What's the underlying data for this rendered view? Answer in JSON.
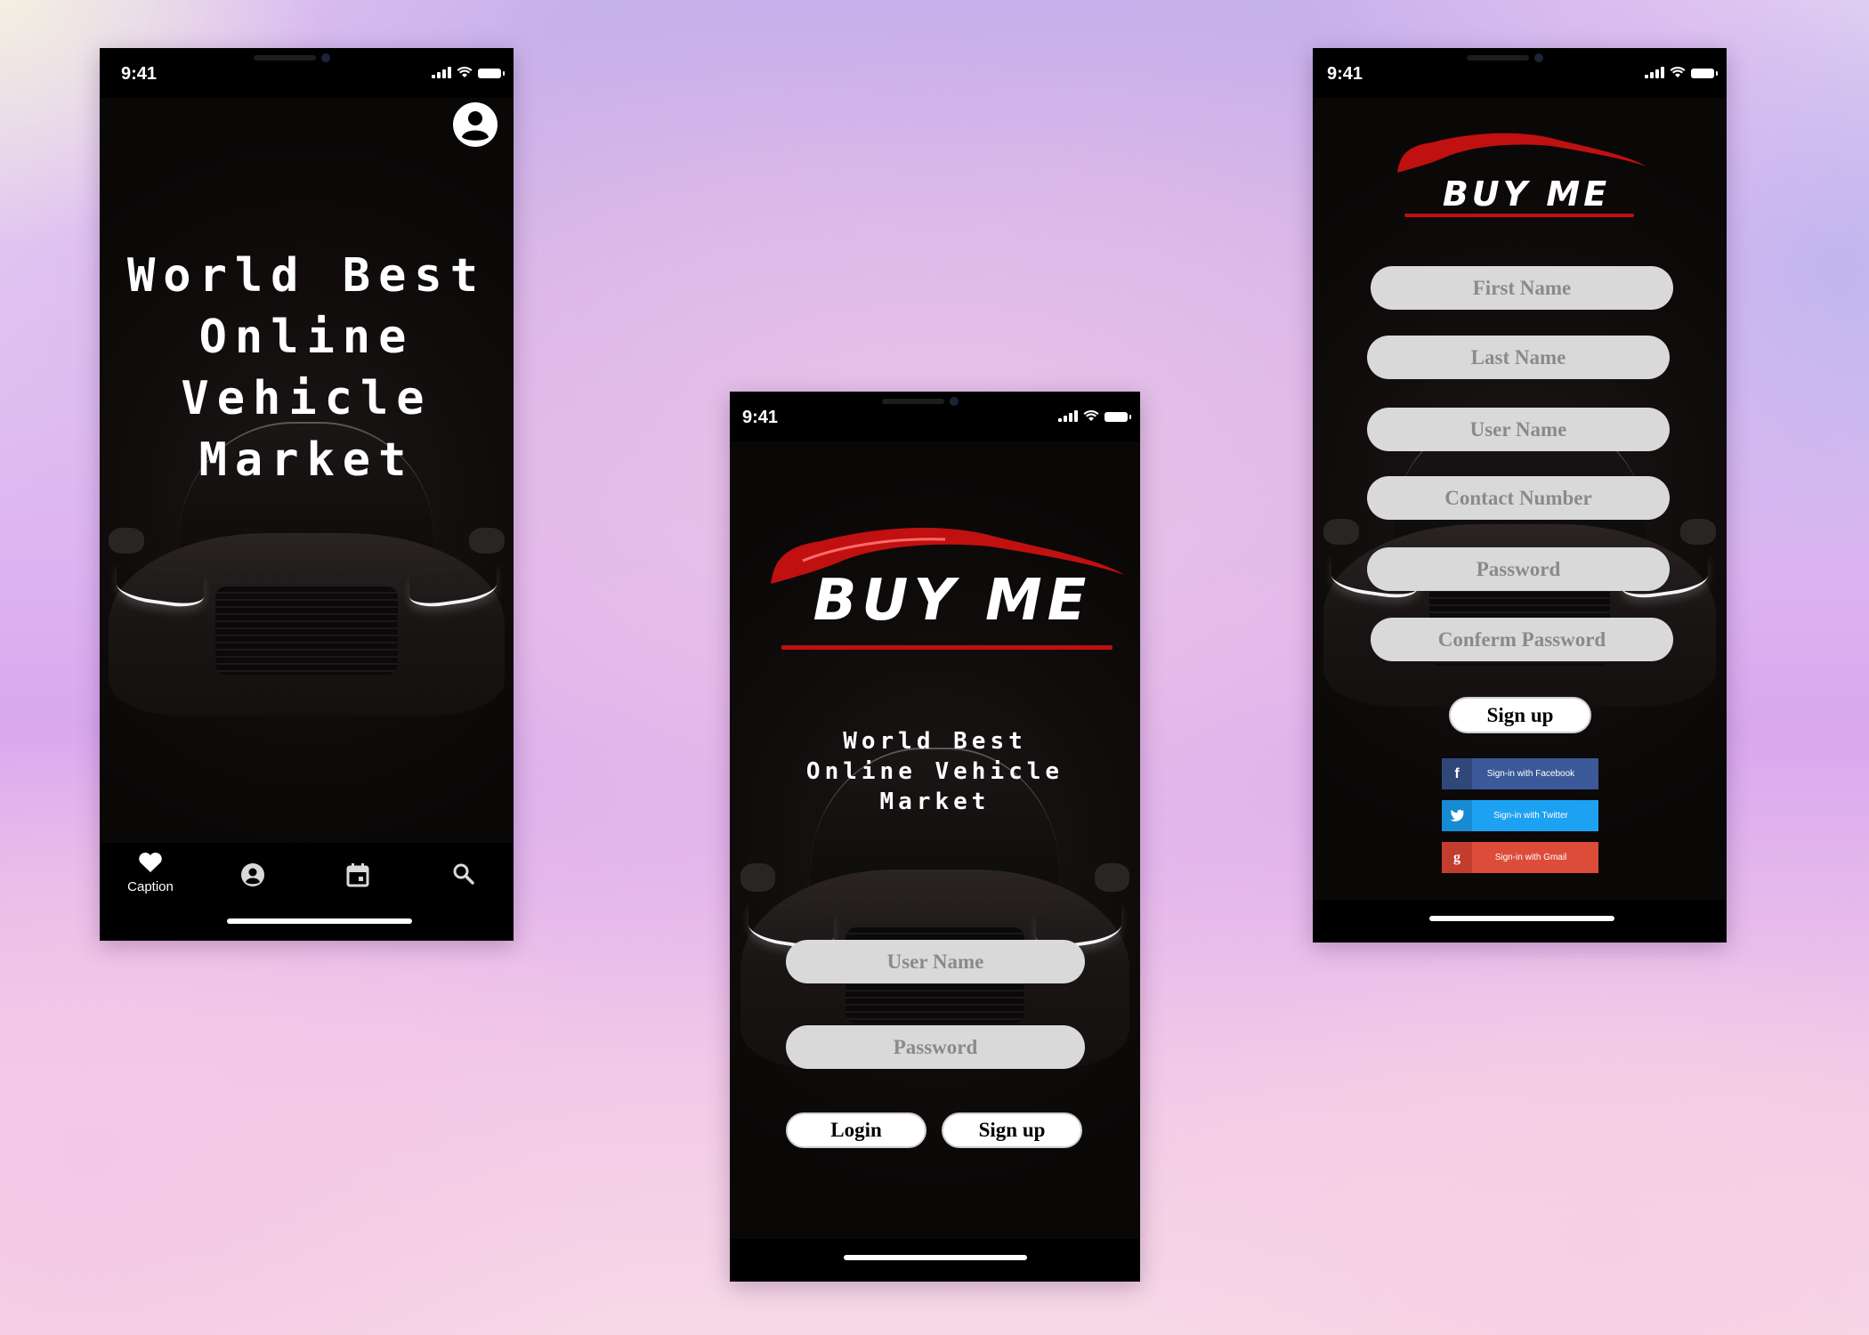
{
  "status": {
    "time": "9:41"
  },
  "screen1": {
    "headline": [
      "World Best",
      "Online",
      "Vehicle",
      "Market"
    ],
    "nav": {
      "caption_label": "Caption"
    }
  },
  "screen2": {
    "logo": "BUY ME",
    "headline": [
      "World Best",
      "Online Vehicle",
      "Market"
    ],
    "fields": {
      "username_placeholder": "User Name",
      "password_placeholder": "Password"
    },
    "buttons": {
      "login": "Login",
      "signup": "Sign up"
    }
  },
  "screen3": {
    "logo": "BUY ME",
    "fields": {
      "first_name": "First Name",
      "last_name": "Last Name",
      "user_name": "User Name",
      "contact_number": "Contact Number",
      "password": "Password",
      "confirm_password": "Conferm Password"
    },
    "buttons": {
      "signup": "Sign up"
    },
    "social": {
      "facebook": {
        "label": "Sign-in with Facebook",
        "icon": "f",
        "color": "#3b5998"
      },
      "twitter": {
        "label": "Sign-in with Twitter",
        "icon": "t",
        "color": "#1da1f2"
      },
      "gmail": {
        "label": "Sign-in with Gmail",
        "icon": "g",
        "color": "#dd4b39"
      }
    }
  }
}
